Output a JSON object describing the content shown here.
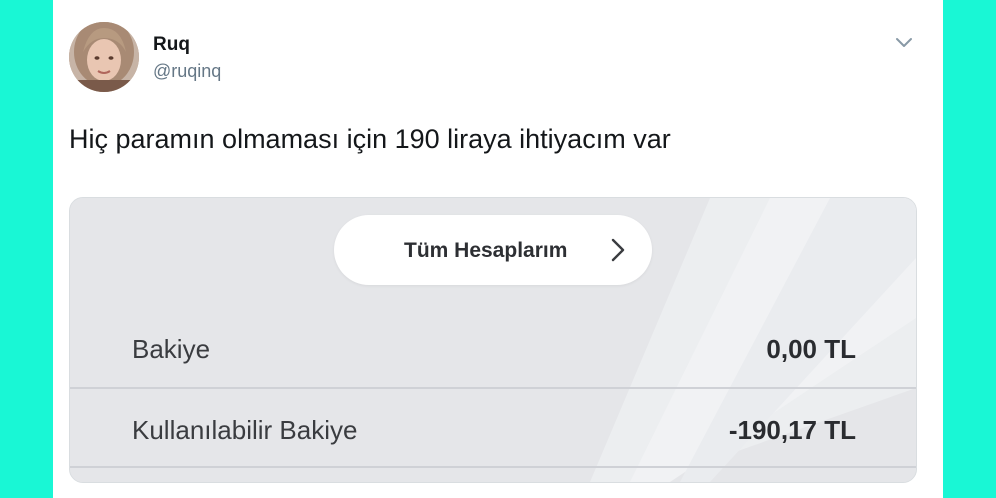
{
  "author": {
    "name": "Ruq",
    "handle": "@ruqinq",
    "avatar_icon": "profile-photo"
  },
  "menu_icon": "chevron-down",
  "tweet": {
    "text": "Hiç paramın olmaması için 190 liraya ihtiyacım var"
  },
  "banking_screenshot": {
    "accounts_button": {
      "label": "Tüm Hesaplarım",
      "icon": "chevron-right"
    },
    "balances": [
      {
        "label": "Bakiye",
        "value": "0,00 TL"
      },
      {
        "label": "Kullanılabilir Bakiye",
        "value": "-190,17 TL"
      }
    ]
  },
  "colors": {
    "page_background": "#19f7d5",
    "card_background": "#ffffff",
    "handle_gray": "#657786"
  }
}
